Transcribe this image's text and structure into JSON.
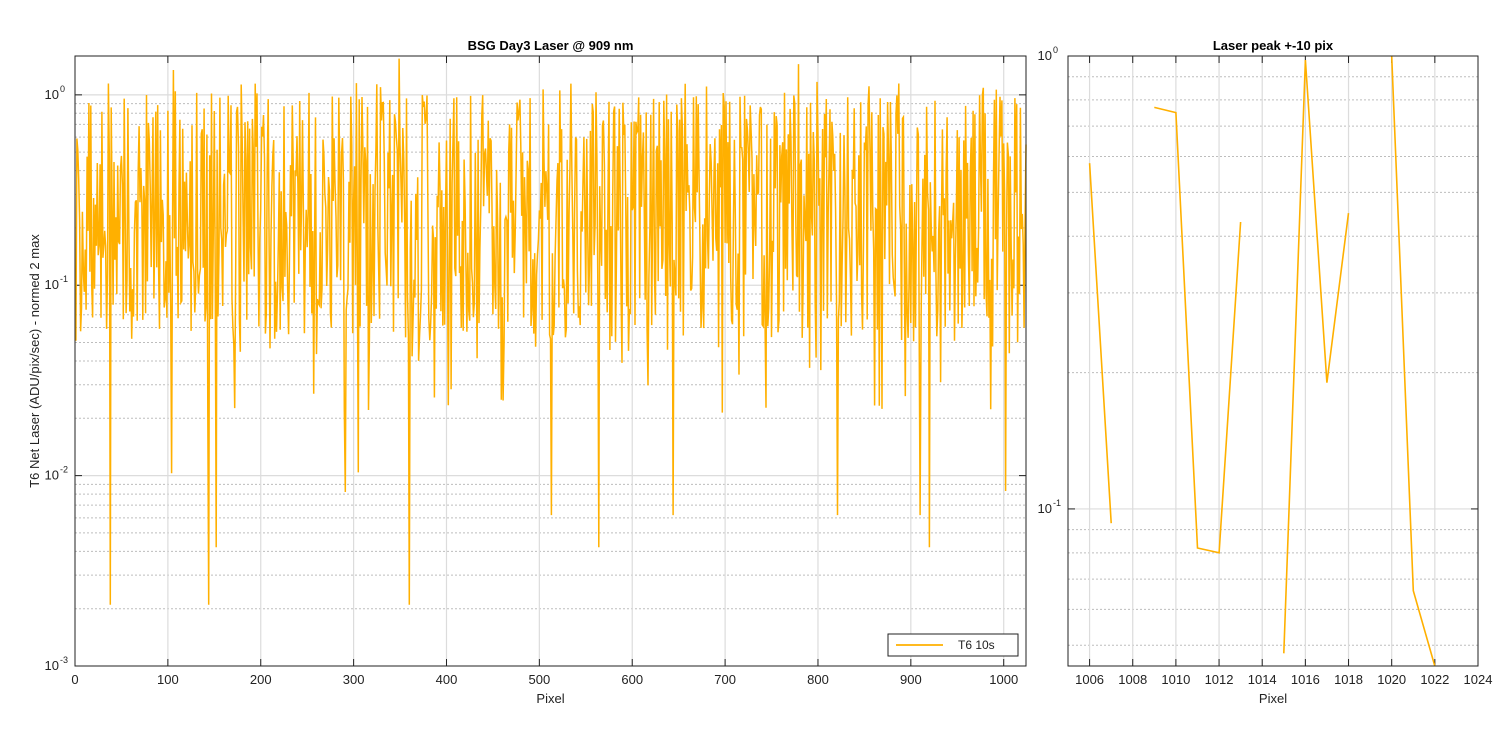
{
  "chart_data": [
    {
      "type": "line",
      "title": "BSG  Day3 Laser @ 909 nm",
      "xlabel": "Pixel",
      "ylabel": "T6 Net Laser (ADU/pix/sec) - normed 2 max",
      "xlim": [
        0,
        1024
      ],
      "ylim": [
        0.001,
        1.6
      ],
      "yscale": "log",
      "grid": true,
      "legend_position": "bottom-right",
      "x_ticks": [
        "0",
        "100",
        "200",
        "300",
        "400",
        "500",
        "600",
        "700",
        "800",
        "900",
        "1000"
      ],
      "y_ticks": [
        {
          "mantissa": "10",
          "exp": "-3",
          "value": 0.001
        },
        {
          "mantissa": "10",
          "exp": "-2",
          "value": 0.01
        },
        {
          "mantissa": "10",
          "exp": "-1",
          "value": 0.1
        },
        {
          "mantissa": "10",
          "exp": "0",
          "value": 1
        }
      ],
      "series": [
        {
          "name": "T6 10s",
          "color": "#ffb000",
          "x_range": [
            1,
            1024
          ],
          "generator": "noisy-log-uniform",
          "typical_range": [
            0.05,
            1.0
          ]
        }
      ],
      "notable_dips": [
        {
          "x": 38,
          "y": 0.0021
        },
        {
          "x": 104,
          "y": 0.0103
        },
        {
          "x": 144,
          "y": 0.0021
        },
        {
          "x": 152,
          "y": 0.0042
        },
        {
          "x": 291,
          "y": 0.0082
        },
        {
          "x": 305,
          "y": 0.0104
        },
        {
          "x": 360,
          "y": 0.0021
        },
        {
          "x": 513,
          "y": 0.0062
        },
        {
          "x": 564,
          "y": 0.0042
        },
        {
          "x": 644,
          "y": 0.0062
        },
        {
          "x": 821,
          "y": 0.0062
        },
        {
          "x": 910,
          "y": 0.0062
        },
        {
          "x": 920,
          "y": 0.0042
        },
        {
          "x": 1002,
          "y": 0.0083
        }
      ],
      "notable_peaks": [
        {
          "x": 106,
          "y": 1.35
        },
        {
          "x": 349,
          "y": 1.55
        },
        {
          "x": 779,
          "y": 1.45
        }
      ]
    },
    {
      "type": "line",
      "title": "Laser peak +-10 pix",
      "xlabel": "Pixel",
      "ylabel": "",
      "xlim": [
        1005,
        1024
      ],
      "ylim": [
        0.045,
        1.0
      ],
      "yscale": "log",
      "grid": true,
      "x_ticks": [
        "1006",
        "1008",
        "1010",
        "1012",
        "1014",
        "1016",
        "1018",
        "1020",
        "1022",
        "1024"
      ],
      "y_ticks": [
        {
          "mantissa": "10",
          "exp": "-1",
          "value": 0.1
        },
        {
          "mantissa": "10",
          "exp": "0",
          "value": 1
        }
      ],
      "series": [
        {
          "name": "T6 10s",
          "color": "#ffb000",
          "x": [
            1006,
            1007,
            1008,
            1009,
            1010,
            1011,
            1012,
            1013,
            1014,
            1015,
            1016,
            1017,
            1018,
            1019,
            1020,
            1021,
            1022,
            1023
          ],
          "y": [
            0.58,
            0.093,
            null,
            0.77,
            0.75,
            0.082,
            0.08,
            0.43,
            null,
            0.048,
            0.98,
            0.19,
            0.45,
            null,
            1.0,
            0.066,
            0.045,
            0.035
          ]
        }
      ]
    }
  ]
}
